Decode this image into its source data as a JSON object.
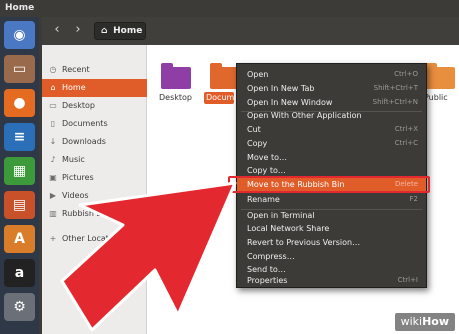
{
  "window": {
    "title": "Home"
  },
  "toolbar": {
    "back_icon": "chevron-left-icon",
    "forward_icon": "chevron-right-icon",
    "location": "Home"
  },
  "sidebar": {
    "items": [
      {
        "label": "Recent",
        "icon": "clock-icon"
      },
      {
        "label": "Home",
        "icon": "home-icon",
        "active": true
      },
      {
        "label": "Desktop",
        "icon": "folder-icon"
      },
      {
        "label": "Documents",
        "icon": "document-icon"
      },
      {
        "label": "Downloads",
        "icon": "download-icon"
      },
      {
        "label": "Music",
        "icon": "music-icon"
      },
      {
        "label": "Pictures",
        "icon": "image-icon"
      },
      {
        "label": "Videos",
        "icon": "video-icon"
      },
      {
        "label": "Rubbish Bin",
        "icon": "trash-icon"
      },
      {
        "label": "Other Locations",
        "icon": "plus-icon"
      }
    ]
  },
  "content": {
    "folders": [
      {
        "label": "Desktop",
        "color": "#8e3ea5"
      },
      {
        "label": "Documents",
        "color": "#e0682d",
        "selected": true
      },
      {
        "label": "",
        "color": "#e88e3f"
      },
      {
        "label": "",
        "color": "#e88e3f"
      },
      {
        "label": "Public",
        "color": "#e88e3f"
      }
    ]
  },
  "context_menu": {
    "items": [
      {
        "label": "Open",
        "shortcut": "Ctrl+O"
      },
      {
        "label": "Open In New Tab",
        "shortcut": "Shift+Ctrl+T"
      },
      {
        "label": "Open In New Window",
        "shortcut": "Shift+Ctrl+N"
      },
      {
        "label": "Open With Other Application",
        "shortcut": ""
      },
      {
        "label": "Cut",
        "shortcut": "Ctrl+X"
      },
      {
        "label": "Copy",
        "shortcut": "Ctrl+C"
      },
      {
        "label": "Move to…",
        "shortcut": ""
      },
      {
        "label": "Copy to…",
        "shortcut": ""
      },
      {
        "label": "Move to the Rubbish Bin",
        "shortcut": "Delete",
        "highlighted": true
      },
      {
        "label": "Rename",
        "shortcut": "F2"
      },
      {
        "label": "Open in Terminal",
        "shortcut": ""
      },
      {
        "label": "Local Network Share",
        "shortcut": ""
      },
      {
        "label": "Revert to Previous Version…",
        "shortcut": ""
      },
      {
        "label": "Compress…",
        "shortcut": ""
      },
      {
        "label": "Send to…",
        "shortcut": ""
      },
      {
        "label": "Properties",
        "shortcut": "Ctrl+I"
      }
    ]
  },
  "launcher": {
    "apps": [
      {
        "name": "ubuntu-icon",
        "color": "#4a78c2"
      },
      {
        "name": "files-icon",
        "color": "#9a6a4c"
      },
      {
        "name": "firefox-icon",
        "color": "#e46b1f"
      },
      {
        "name": "writer-icon",
        "color": "#2a6fb8"
      },
      {
        "name": "calc-icon",
        "color": "#3c9a3a"
      },
      {
        "name": "impress-icon",
        "color": "#c8512a"
      },
      {
        "name": "software-icon",
        "color": "#d97d2a"
      },
      {
        "name": "amazon-icon",
        "color": "#222222"
      },
      {
        "name": "settings-icon",
        "color": "#6a6f78"
      }
    ]
  },
  "watermark": {
    "wiki": "wiki",
    "how": "How"
  },
  "colors": {
    "accent": "#e05d2a",
    "arrow": "#e3292f",
    "menu_bg": "#3c3b37"
  }
}
